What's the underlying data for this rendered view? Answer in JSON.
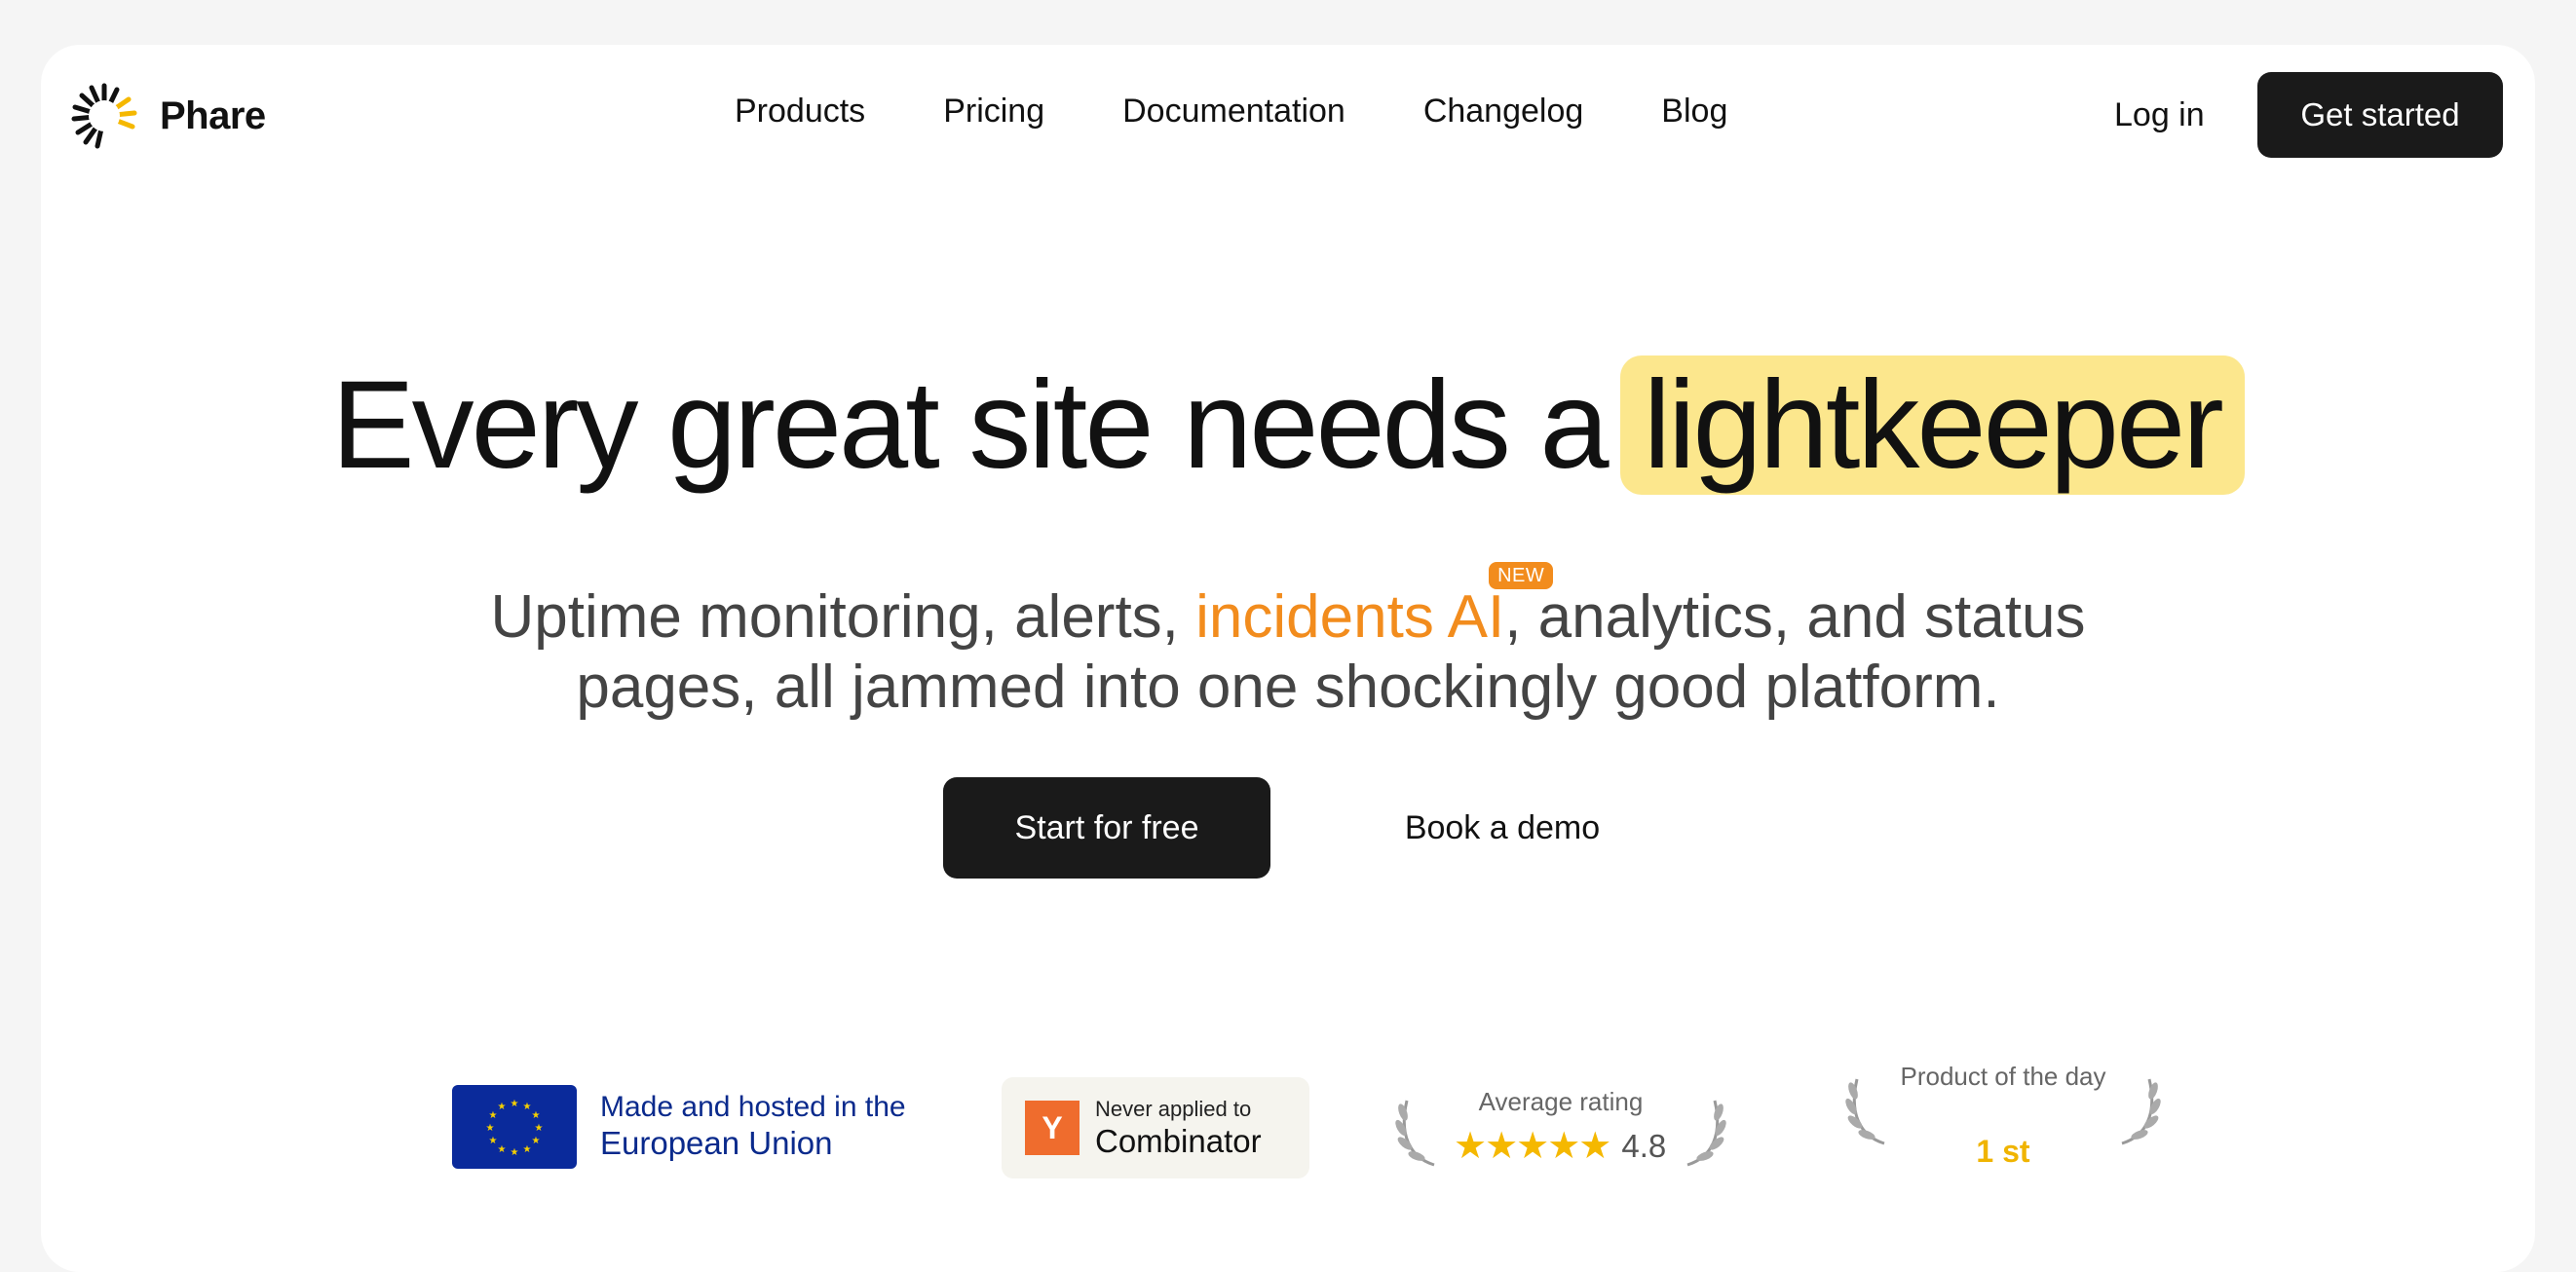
{
  "brand": {
    "name": "Phare"
  },
  "nav": {
    "links": [
      "Products",
      "Pricing",
      "Documentation",
      "Changelog",
      "Blog"
    ],
    "login": "Log in",
    "cta": "Get started"
  },
  "hero": {
    "title_main": "Every great site needs a",
    "title_highlight": "lightkeeper",
    "subtitle_pre": "Uptime monitoring, alerts,",
    "subtitle_accent": "incidents AI",
    "subtitle_badge": "NEW",
    "subtitle_post": ", analytics, and status",
    "subtitle_line2": "pages, all jammed into one shockingly good platform.",
    "primary_cta": "Start for free",
    "secondary_cta": "Book a demo"
  },
  "badges": {
    "eu": {
      "line1": "Made and hosted in the",
      "line2": "European Union"
    },
    "yc": {
      "logo": "Y",
      "line1": "Never applied to",
      "line2": "Combinator"
    },
    "rating": {
      "label": "Average rating",
      "value": "4.8",
      "stars": 4.8
    },
    "potd": {
      "label": "Product of the day",
      "rank": "1 st"
    }
  },
  "colors": {
    "accent": "#f28c1d",
    "highlight": "#fce78d",
    "dark": "#1a1a1a",
    "eu_blue": "#0a2a9b",
    "yc_orange": "#ef6c2d",
    "star": "#f5b800"
  },
  "icons": [
    "phare-logo-icon",
    "eu-flag-icon",
    "yc-logo-icon",
    "laurel-icon",
    "star-icon"
  ]
}
